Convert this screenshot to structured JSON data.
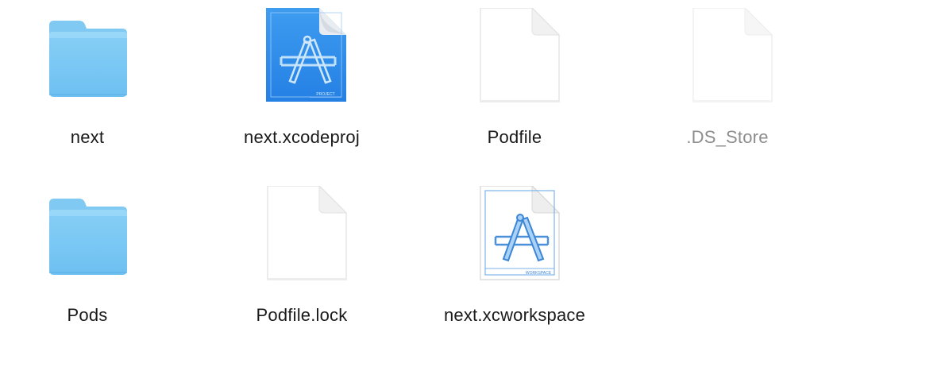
{
  "window": {
    "view": "icon-view"
  },
  "files": [
    {
      "id": "next",
      "name": "next",
      "kind": "folder-icon",
      "hidden": false
    },
    {
      "id": "next-xcodeproj",
      "name": "next.xcodeproj",
      "kind": "xcodeproj-icon",
      "badge": "PROJECT",
      "hidden": false
    },
    {
      "id": "podfile",
      "name": "Podfile",
      "kind": "document-icon",
      "hidden": false
    },
    {
      "id": "ds-store",
      "name": ".DS_Store",
      "kind": "document-icon",
      "hidden": true
    },
    {
      "id": "pods",
      "name": "Pods",
      "kind": "folder-icon",
      "hidden": false
    },
    {
      "id": "podfile-lock",
      "name": "Podfile.lock",
      "kind": "document-icon",
      "hidden": false
    },
    {
      "id": "next-xcworkspace",
      "name": "next.xcworkspace",
      "kind": "xcworkspace-icon",
      "badge": "WORKSPACE",
      "hidden": false
    }
  ],
  "colors": {
    "folder_top": "#8fd3f7",
    "folder_body": "#74c4f2",
    "xcode_blue": "#2d8ae8",
    "label_text": "#1a1a1a",
    "hidden_label_text": "#8d8d8d"
  }
}
